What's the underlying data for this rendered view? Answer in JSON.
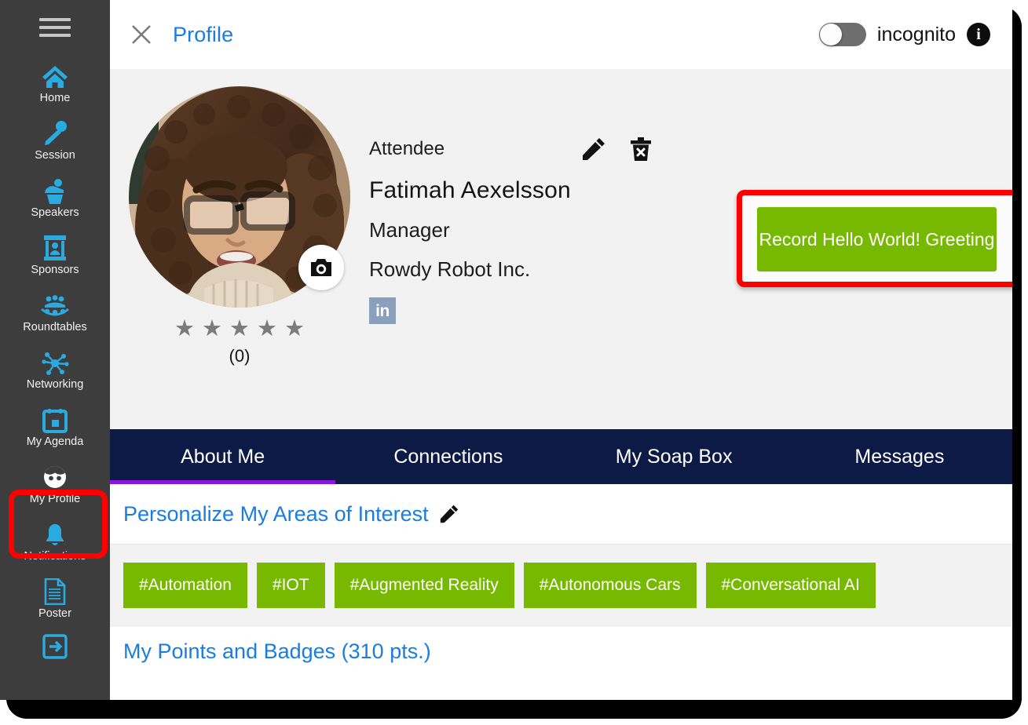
{
  "window": {
    "title": "Profile"
  },
  "sidebar": {
    "menu_icon": "hamburger-menu-icon",
    "items": [
      {
        "label": "Home",
        "icon": "home-icon"
      },
      {
        "label": "Session",
        "icon": "microphone-icon"
      },
      {
        "label": "Speakers",
        "icon": "podium-speaker-icon"
      },
      {
        "label": "Sponsors",
        "icon": "booth-icon"
      },
      {
        "label": "Roundtables",
        "icon": "group-table-icon"
      },
      {
        "label": "Networking",
        "icon": "network-nodes-icon"
      },
      {
        "label": "My Agenda",
        "icon": "calendar-icon"
      },
      {
        "label": "My Profile",
        "icon": "face-avatar-icon"
      },
      {
        "label": "Notifications",
        "icon": "bell-icon"
      },
      {
        "label": "Poster",
        "icon": "document-icon"
      },
      {
        "label": "",
        "icon": "logout-arrow-icon"
      }
    ],
    "active_item": "My Profile"
  },
  "topbar": {
    "close_label": "close-icon",
    "title": "Profile",
    "incognito_label": "incognito",
    "incognito_on": false,
    "info_label": "i"
  },
  "profile": {
    "avatar_alt": "profile-photo",
    "camera_label": "camera-icon",
    "stars": [
      "★",
      "★",
      "★",
      "★",
      "★"
    ],
    "rating_count": "(0)",
    "role": "Attendee",
    "name": "Fatimah Aexelsson",
    "job_title": "Manager",
    "company": "Rowdy Robot Inc.",
    "linkedin_label": "in",
    "edit_label": "pencil-icon",
    "delete_label": "trash-delete-icon",
    "record_button": "Record Hello World!\nGreeting"
  },
  "tabs": [
    {
      "label": "About Me",
      "active": true
    },
    {
      "label": "Connections",
      "active": false
    },
    {
      "label": "My Soap Box",
      "active": false
    },
    {
      "label": "Messages",
      "active": false
    }
  ],
  "interests": {
    "heading": "Personalize My Areas of Interest",
    "edit_label": "pencil-icon",
    "tags": [
      "#Automation",
      "#IOT",
      "#Augmented Reality",
      "#Autonomous Cars",
      "#Conversational AI"
    ]
  },
  "points": {
    "label": "My Points and Badges (310 pts.)"
  },
  "colors": {
    "sidebar_bg": "#3d3d3d",
    "icon_blue": "#29abe2",
    "link_blue": "#1b7ce0",
    "tabbar_navy": "#0c1a45",
    "tab_underline": "#8a16e0",
    "accent_green": "#76b900",
    "annotation_red": "#ff0000",
    "panel_gray": "#f2f2f2"
  }
}
